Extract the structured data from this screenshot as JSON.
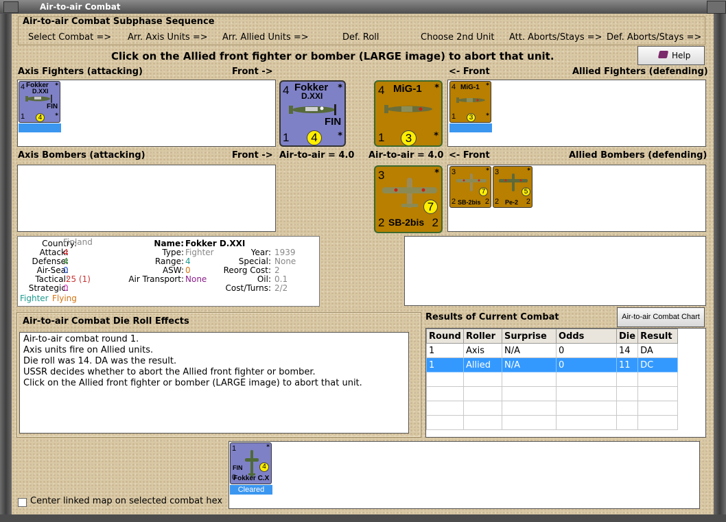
{
  "window": {
    "title": "Air-to-air Combat"
  },
  "sequence": {
    "title": "Air-to-air Combat Subphase Sequence",
    "steps": [
      "Select Combat =>",
      "Arr. Axis Units =>",
      "Arr. Allied Units =>",
      "Def. Roll",
      "Choose 2nd Unit",
      "Att. Aborts/Stays =>",
      "Def. Aborts/Stays =>"
    ]
  },
  "instruction": "Click on the Allied front fighter or bomber  (LARGE image) to abort that unit.",
  "help_label": "Help",
  "axis_fighters": {
    "label": "Axis Fighters (attacking)",
    "front_label": "Front ->",
    "unit": {
      "top": "Fokker",
      "sub": "D.XXI",
      "nation": "FIN",
      "attack": "4",
      "range": "4",
      "defense": "1",
      "star": "*"
    }
  },
  "front_axis": {
    "name": "Fokker",
    "sub": "D.XXI",
    "nation": "FIN",
    "attack": "4",
    "range": "4",
    "defense": "1",
    "star": "*"
  },
  "front_allied": {
    "name": "MiG-1",
    "attack": "4",
    "range": "3",
    "defense": "1",
    "star": "*"
  },
  "allied_fighters": {
    "label": "Allied Fighters (defending)",
    "front_label": "<- Front",
    "unit": {
      "name": "MiG-1",
      "attack": "4",
      "range": "3",
      "defense": "1",
      "star": "*"
    }
  },
  "axis_bombers": {
    "label": "Axis Bombers (attacking)",
    "front_label": "Front ->"
  },
  "air_to_air_axis": "Air-to-air = 4.0",
  "air_to_air_allied": "Air-to-air = 4.0",
  "front_bomber": {
    "name": "SB-2bis",
    "attack": "3",
    "range": "7",
    "defense": "2",
    "strategic": "2",
    "star": "*"
  },
  "allied_bombers": {
    "label": "Allied Bombers (defending)",
    "front_label": "<- Front",
    "units": [
      {
        "name": "SB-2bis",
        "attack": "3",
        "range": "7",
        "defense": "2",
        "strategic": "2",
        "star": "*"
      },
      {
        "name": "Pe-2",
        "attack": "3",
        "range": "5",
        "defense": "2",
        "strategic": "2",
        "star": "*"
      }
    ]
  },
  "unit_info": {
    "country_k": "Country:",
    "country": "Finland",
    "attack_k": "Attack:",
    "attack": "4",
    "defense_k": "Defense:",
    "defense": "4",
    "airsea_k": "Air-Sea:",
    "airsea": "0",
    "tactical_k": "Tactical:",
    "tactical": ".25 (1)",
    "strategic_k": "Strategic:",
    "strategic": "0",
    "flag1": "Fighter",
    "flag2": "Flying",
    "name_k": "Name:",
    "name": "Fokker D.XXI",
    "type_k": "Type:",
    "type": "Fighter",
    "range_k": "Range:",
    "range": "4",
    "asw_k": "ASW:",
    "asw": "0",
    "airtransport_k": "Air Transport:",
    "airtransport": "None",
    "year_k": "Year:",
    "year": "1939",
    "special_k": "Special:",
    "special": "None",
    "reorg_k": "Reorg Cost:",
    "reorg": "2",
    "oil_k": "Oil:",
    "oil": "0.1",
    "costturns_k": "Cost/Turns:",
    "costturns": "2/2"
  },
  "die_roll": {
    "title": "Air-to-air Combat Die Roll Effects",
    "lines": [
      "Air-to-air combat round 1.",
      "Axis units fire on Allied units.",
      "Die roll was 14.  DA was the result.",
      "USSR decides whether to abort the Allied front fighter or bomber.",
      "Click on the Allied front fighter or bomber  (LARGE image) to abort that unit."
    ]
  },
  "results": {
    "title": "Results of Current Combat",
    "chart_button": "Air-to-air Combat Chart",
    "headers": [
      "Round",
      "Roller",
      "Surprise",
      "Odds",
      "Die",
      "Result"
    ],
    "rows": [
      [
        "1",
        "Axis",
        "N/A",
        "0",
        "14",
        "DA"
      ],
      [
        "1",
        "Allied",
        "N/A",
        "0",
        "11",
        "DC"
      ]
    ]
  },
  "bottom_unit": {
    "nation": "FIN",
    "attack": "1",
    "range": "4",
    "name": "Fokker C.X",
    "cleared": "Cleared",
    "star": "*",
    "defense": "0"
  },
  "center_map_label": "Center linked map on selected combat hex",
  "colors": {
    "axis_counter": "#7f81c6",
    "allied_counter": "#b87f00",
    "selection": "#3399ff"
  }
}
